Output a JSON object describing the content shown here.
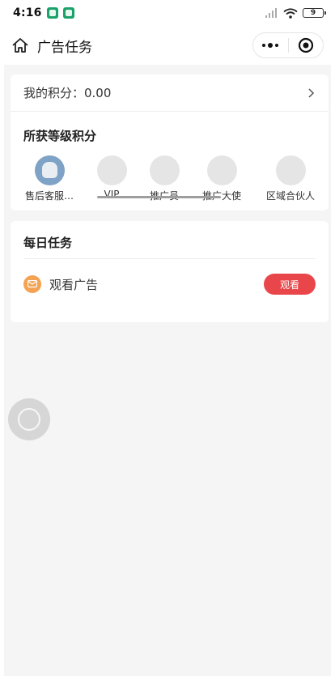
{
  "status_bar": {
    "time": "4:16",
    "battery": "9",
    "icons": [
      "shield-app-icon",
      "shield-app-icon",
      "signal-icon",
      "wifi-icon",
      "battery-icon"
    ]
  },
  "nav": {
    "title": "广告任务",
    "home_icon": "home-icon",
    "more_icon": "more-dots-icon",
    "close_icon": "target-circle-icon"
  },
  "points": {
    "label": "我的积分：0.00",
    "chevron_icon": "chevron-right-icon"
  },
  "levels": {
    "title": "所获等级积分",
    "items": [
      {
        "label": "售后客服…",
        "active": true
      },
      {
        "label": "VIP",
        "active": false
      },
      {
        "label": "推广员",
        "active": false
      },
      {
        "label": "推广大使",
        "active": false
      },
      {
        "label": "区域合伙人",
        "active": false
      }
    ]
  },
  "daily": {
    "title": "每日任务",
    "tasks": [
      {
        "label": "观看广告",
        "button": "观看",
        "icon": "message-icon"
      }
    ]
  },
  "colors": {
    "accent": "#e8464a",
    "task_icon": "#f3a353",
    "active_avatar": "#7ea3c6",
    "background": "#f5f5f5"
  }
}
